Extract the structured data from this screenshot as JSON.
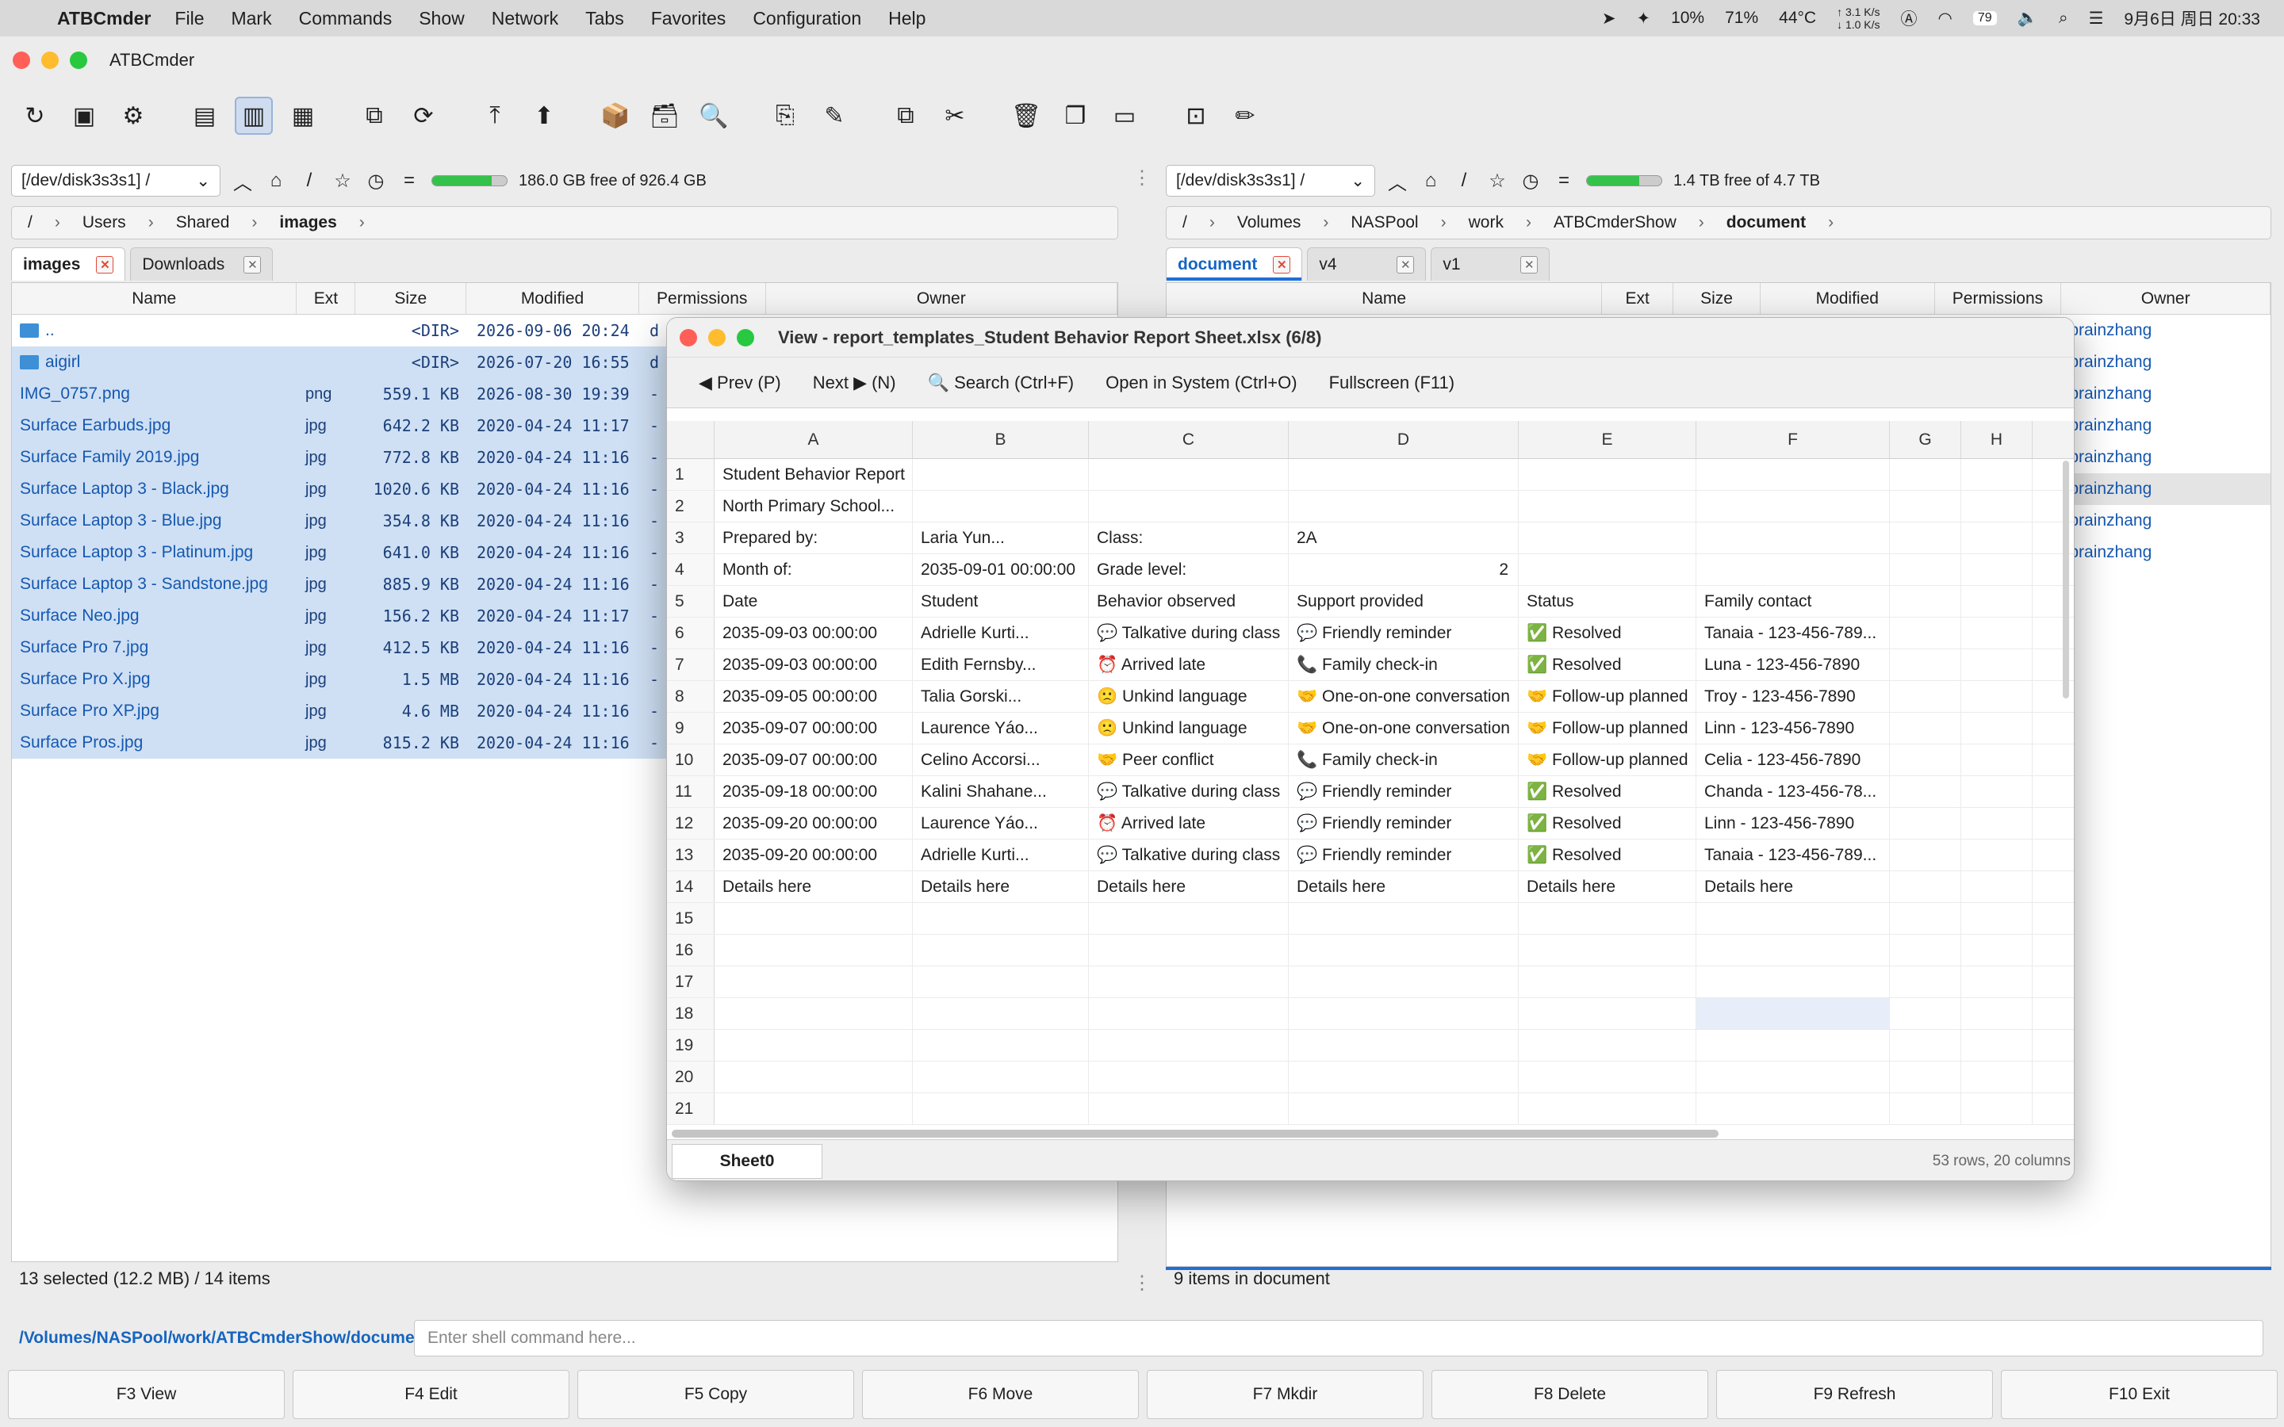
{
  "menubar": {
    "app": "ATBCmder",
    "items": [
      "File",
      "Mark",
      "Commands",
      "Show",
      "Network",
      "Tabs",
      "Favorites",
      "Configuration",
      "Help"
    ],
    "cpu": "10%",
    "mem": "71%",
    "temp": "44°C",
    "net_up": "↑ 3.1 K/s",
    "net_down": "↓ 1.0 K/s",
    "battery": "79",
    "clock": "9月6日 周日 20:33"
  },
  "window": {
    "title": "ATBCmder"
  },
  "toolbar": {
    "icons": [
      "refresh-icon",
      "terminal-icon",
      "settings-icon",
      "brief-view-icon",
      "full-view-icon",
      "thumbnail-view-icon",
      "tree-icon",
      "sync-icon",
      "go-top-icon",
      "go-up-icon",
      "pack-icon",
      "unpack-icon",
      "search-files-icon",
      "copy-names-icon",
      "multi-rename-icon",
      "copy-icon",
      "cut-icon",
      "delete-icon",
      "duplicate-icon",
      "new-folder-icon",
      "preview-icon",
      "edit-icon"
    ]
  },
  "left": {
    "device": "[/dev/disk3s3s1] /",
    "free": "186.0 GB free of 926.4 GB",
    "used_fraction": 0.8,
    "crumbs": [
      "/",
      "Users",
      "Shared",
      "images"
    ],
    "tabs": [
      {
        "label": "images"
      },
      {
        "label": "Downloads"
      }
    ],
    "columns": [
      "Name",
      "Ext",
      "Size",
      "Modified",
      "Permissions",
      "Owner"
    ],
    "rows": [
      {
        "name": "..",
        "ext": "",
        "size": "<DIR>",
        "mod": "2026-09-06 20:24",
        "perm": "d",
        "dir": true,
        "sel": false
      },
      {
        "name": "aigirl",
        "ext": "",
        "size": "<DIR>",
        "mod": "2026-07-20 16:55",
        "perm": "d",
        "dir": true,
        "sel": true
      },
      {
        "name": "IMG_0757.png",
        "ext": "png",
        "size": "559.1 KB",
        "mod": "2026-08-30 19:39",
        "perm": "-",
        "sel": true
      },
      {
        "name": "Surface Earbuds.jpg",
        "ext": "jpg",
        "size": "642.2 KB",
        "mod": "2020-04-24 11:17",
        "perm": "-",
        "sel": true
      },
      {
        "name": "Surface Family 2019.jpg",
        "ext": "jpg",
        "size": "772.8 KB",
        "mod": "2020-04-24 11:16",
        "perm": "-",
        "sel": true
      },
      {
        "name": "Surface Laptop 3 - Black.jpg",
        "ext": "jpg",
        "size": "1020.6 KB",
        "mod": "2020-04-24 11:16",
        "perm": "-",
        "sel": true
      },
      {
        "name": "Surface Laptop 3 - Blue.jpg",
        "ext": "jpg",
        "size": "354.8 KB",
        "mod": "2020-04-24 11:16",
        "perm": "-",
        "sel": true
      },
      {
        "name": "Surface Laptop 3 - Platinum.jpg",
        "ext": "jpg",
        "size": "641.0 KB",
        "mod": "2020-04-24 11:16",
        "perm": "-",
        "sel": true
      },
      {
        "name": "Surface Laptop 3 - Sandstone.jpg",
        "ext": "jpg",
        "size": "885.9 KB",
        "mod": "2020-04-24 11:16",
        "perm": "-",
        "sel": true
      },
      {
        "name": "Surface Neo.jpg",
        "ext": "jpg",
        "size": "156.2 KB",
        "mod": "2020-04-24 11:17",
        "perm": "-",
        "sel": true
      },
      {
        "name": "Surface Pro 7.jpg",
        "ext": "jpg",
        "size": "412.5 KB",
        "mod": "2020-04-24 11:16",
        "perm": "-",
        "sel": true
      },
      {
        "name": "Surface Pro X.jpg",
        "ext": "jpg",
        "size": "1.5 MB",
        "mod": "2020-04-24 11:16",
        "perm": "-",
        "sel": true
      },
      {
        "name": "Surface Pro XP.jpg",
        "ext": "jpg",
        "size": "4.6 MB",
        "mod": "2020-04-24 11:16",
        "perm": "-",
        "sel": true
      },
      {
        "name": "Surface Pros.jpg",
        "ext": "jpg",
        "size": "815.2 KB",
        "mod": "2020-04-24 11:16",
        "perm": "-",
        "sel": true
      }
    ],
    "status": "13 selected (12.2 MB) / 14 items"
  },
  "right": {
    "device": "[/dev/disk3s3s1] /",
    "free": "1.4 TB free of 4.7 TB",
    "used_fraction": 0.7,
    "crumbs": [
      "/",
      "Volumes",
      "NASPool",
      "work",
      "ATBCmderShow",
      "document"
    ],
    "tabs": [
      {
        "label": "document"
      },
      {
        "label": "v4"
      },
      {
        "label": "v1"
      }
    ],
    "columns": [
      "Name",
      "Ext",
      "Size",
      "Modified",
      "Permissions",
      "Owner"
    ],
    "owners": [
      "brainzhang",
      "brainzhang",
      "brainzhang",
      "brainzhang",
      "brainzhang",
      "brainzhang",
      "brainzhang",
      "brainzhang"
    ],
    "status": "9 items in document"
  },
  "viewer": {
    "title": "View - report_templates_Student Behavior Report Sheet.xlsx (6/8)",
    "prev": "◀ Prev (P)",
    "next": "Next ▶ (N)",
    "search": "🔍 Search (Ctrl+F)",
    "open": "Open in System (Ctrl+O)",
    "fullscreen": "Fullscreen (F11)",
    "cols": [
      "A",
      "B",
      "C",
      "D",
      "E",
      "F",
      "G",
      "H"
    ],
    "rows": [
      [
        "1",
        "Student Behavior Report",
        "",
        "",
        "",
        "",
        "",
        "",
        ""
      ],
      [
        "2",
        "North Primary School...",
        "",
        "",
        "",
        "",
        "",
        "",
        ""
      ],
      [
        "3",
        "Prepared by:",
        "Laria Yun...",
        "Class:",
        "2A",
        "",
        "",
        "",
        ""
      ],
      [
        "4",
        "Month of:",
        "2035-09-01 00:00:00",
        "Grade level:",
        "2",
        "",
        "",
        "",
        ""
      ],
      [
        "5",
        "Date",
        "Student",
        "Behavior observed",
        "Support provided",
        "Status",
        "Family contact",
        "",
        ""
      ],
      [
        "6",
        "2035-09-03 00:00:00",
        "Adrielle Kurti...",
        "💬 Talkative during class",
        "💬 Friendly reminder",
        "✅ Resolved",
        "Tanaia - 123-456-789...",
        "",
        ""
      ],
      [
        "7",
        "2035-09-03 00:00:00",
        "Edith Fernsby...",
        "⏰ Arrived late",
        "📞 Family check-in",
        "✅ Resolved",
        "Luna - 123-456-7890",
        "",
        ""
      ],
      [
        "8",
        "2035-09-05 00:00:00",
        "Talia Gorski...",
        "🙁 Unkind language",
        "🤝 One-on-one conversation",
        "🤝 Follow-up planned",
        "Troy - 123-456-7890",
        "",
        ""
      ],
      [
        "9",
        "2035-09-07 00:00:00",
        "Laurence Yáo...",
        "🙁 Unkind language",
        "🤝 One-on-one conversation",
        "🤝 Follow-up planned",
        "Linn - 123-456-7890",
        "",
        ""
      ],
      [
        "10",
        "2035-09-07 00:00:00",
        "Celino Accorsi...",
        "🤝 Peer conflict",
        "📞 Family check-in",
        "🤝 Follow-up planned",
        "Celia - 123-456-7890",
        "",
        ""
      ],
      [
        "11",
        "2035-09-18 00:00:00",
        "Kalini Shahane...",
        "💬 Talkative during class",
        "💬 Friendly reminder",
        "✅ Resolved",
        "Chanda - 123-456-78...",
        "",
        ""
      ],
      [
        "12",
        "2035-09-20 00:00:00",
        "Laurence Yáo...",
        "⏰ Arrived late",
        "💬 Friendly reminder",
        "✅ Resolved",
        "Linn - 123-456-7890",
        "",
        ""
      ],
      [
        "13",
        "2035-09-20 00:00:00",
        "Adrielle Kurti...",
        "💬 Talkative during class",
        "💬 Friendly reminder",
        "✅ Resolved",
        "Tanaia - 123-456-789...",
        "",
        ""
      ],
      [
        "14",
        "Details here",
        "Details here",
        "Details here",
        "Details here",
        "Details here",
        "Details here",
        "",
        ""
      ],
      [
        "15",
        "",
        "",
        "",
        "",
        "",
        "",
        "",
        ""
      ],
      [
        "16",
        "",
        "",
        "",
        "",
        "",
        "",
        "",
        ""
      ],
      [
        "17",
        "",
        "",
        "",
        "",
        "",
        "",
        "",
        ""
      ],
      [
        "18",
        "",
        "",
        "",
        "",
        "",
        "",
        "",
        ""
      ],
      [
        "19",
        "",
        "",
        "",
        "",
        "",
        "",
        "",
        ""
      ],
      [
        "20",
        "",
        "",
        "",
        "",
        "",
        "",
        "",
        ""
      ],
      [
        "21",
        "",
        "",
        "",
        "",
        "",
        "",
        "",
        ""
      ]
    ],
    "sheet": "Sheet0",
    "info": "53 rows, 20 columns"
  },
  "cmd": {
    "path": "/Volumes/NASPool/work/ATBCmderShow/document",
    "placeholder": "Enter shell command here..."
  },
  "fkeys": [
    "F3 View",
    "F4 Edit",
    "F5 Copy",
    "F6 Move",
    "F7 Mkdir",
    "F8 Delete",
    "F9 Refresh",
    "F10 Exit"
  ]
}
